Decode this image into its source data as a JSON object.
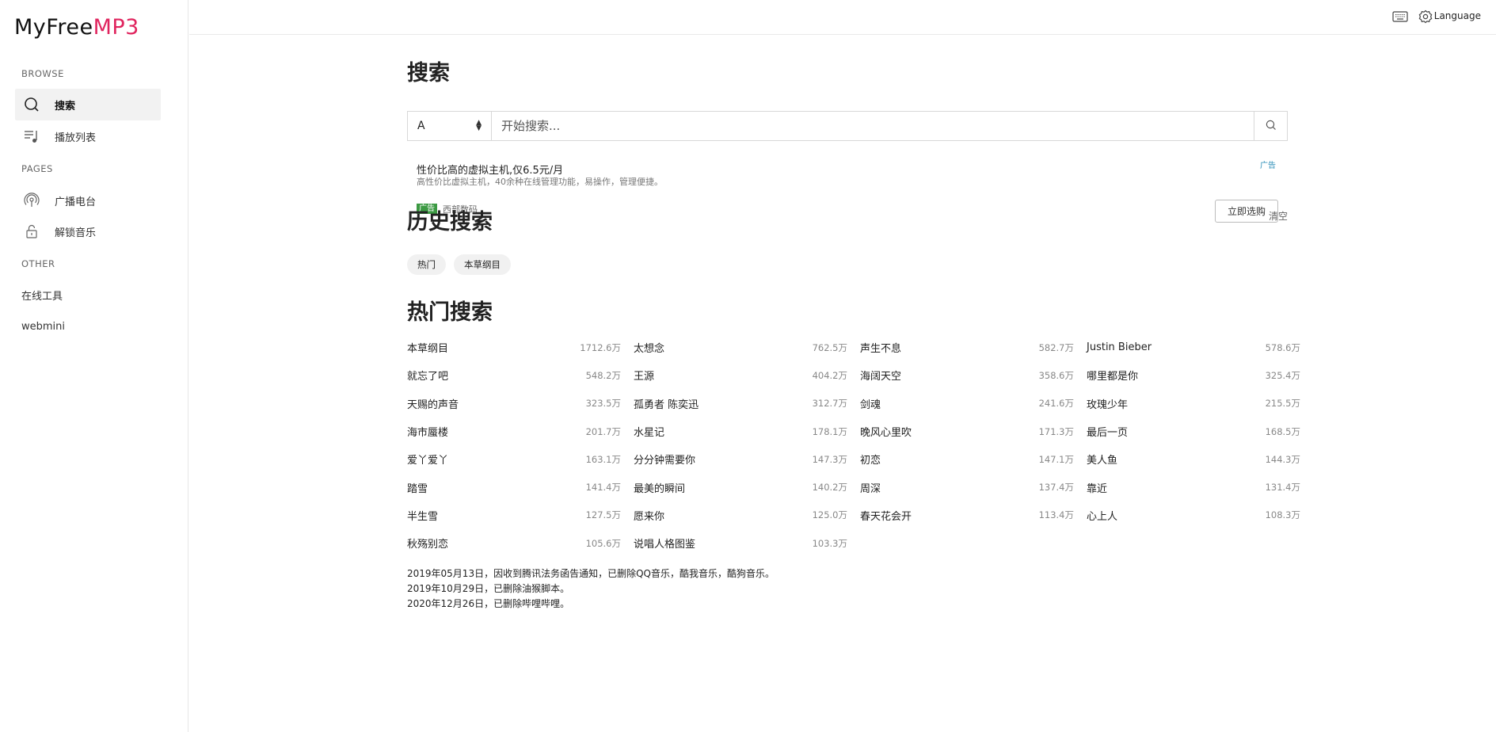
{
  "sidebar": {
    "logo_main": "MyFree",
    "logo_accent": "MP3",
    "sections": [
      {
        "title": "BROWSE",
        "items": [
          {
            "label": "搜索",
            "icon": "search-icon"
          },
          {
            "label": "播放列表",
            "icon": "playlist-icon"
          }
        ]
      },
      {
        "title": "PAGES",
        "items": [
          {
            "label": "广播电台",
            "icon": "podcast-icon"
          },
          {
            "label": "解锁音乐",
            "icon": "unlock-icon"
          }
        ]
      },
      {
        "title": "OTHER",
        "items": [
          {
            "label": "在线工具"
          },
          {
            "label": "webmini"
          }
        ]
      }
    ]
  },
  "topbar": {
    "keyboard_icon": "keyboard-icon",
    "settings_icon": "gear-icon",
    "language_label": "Language"
  },
  "search": {
    "title": "搜索",
    "source_value": "A",
    "placeholder": "开始搜索...",
    "button_icon": "search-icon"
  },
  "ad": {
    "title": "性价比高的虚拟主机,仅6.5元/月",
    "desc": "高性价比虚拟主机，40余种在线管理功能，易操作，管理便捷。",
    "tag": "广告",
    "badge": "广告",
    "brand": "西部数码",
    "button": "立即选购"
  },
  "history": {
    "title": "历史搜索",
    "clear_label": "清空",
    "chips": [
      "热门",
      "本草纲目"
    ]
  },
  "hot": {
    "title": "热门搜索",
    "items": [
      {
        "name": "本草纲目",
        "count": "1712.6万"
      },
      {
        "name": "太想念",
        "count": "762.5万"
      },
      {
        "name": "声生不息",
        "count": "582.7万"
      },
      {
        "name": "Justin Bieber",
        "count": "578.6万"
      },
      {
        "name": "就忘了吧",
        "count": "548.2万"
      },
      {
        "name": "王源",
        "count": "404.2万"
      },
      {
        "name": "海阔天空",
        "count": "358.6万"
      },
      {
        "name": "哪里都是你",
        "count": "325.4万"
      },
      {
        "name": "天赐的声音",
        "count": "323.5万"
      },
      {
        "name": "孤勇者 陈奕迅",
        "count": "312.7万"
      },
      {
        "name": "剑魂",
        "count": "241.6万"
      },
      {
        "name": "玫瑰少年",
        "count": "215.5万"
      },
      {
        "name": "海市蜃楼",
        "count": "201.7万"
      },
      {
        "name": "水星记",
        "count": "178.1万"
      },
      {
        "name": "晚风心里吹",
        "count": "171.3万"
      },
      {
        "name": "最后一页",
        "count": "168.5万"
      },
      {
        "name": "爱丫爱丫",
        "count": "163.1万"
      },
      {
        "name": "分分钟需要你",
        "count": "147.3万"
      },
      {
        "name": "初恋",
        "count": "147.1万"
      },
      {
        "name": "美人鱼",
        "count": "144.3万"
      },
      {
        "name": "踏雪",
        "count": "141.4万"
      },
      {
        "name": "最美的瞬间",
        "count": "140.2万"
      },
      {
        "name": "周深",
        "count": "137.4万"
      },
      {
        "name": "靠近",
        "count": "131.4万"
      },
      {
        "name": "半生雪",
        "count": "127.5万"
      },
      {
        "name": "愿来你",
        "count": "125.0万"
      },
      {
        "name": "春天花会开",
        "count": "113.4万"
      },
      {
        "name": "心上人",
        "count": "108.3万"
      },
      {
        "name": "秋殇别恋",
        "count": "105.6万"
      },
      {
        "name": "说唱人格图鉴",
        "count": "103.3万"
      }
    ]
  },
  "notes": [
    "2019年05月13日，因收到腾讯法务函告通知，已删除QQ音乐，酷我音乐，酷狗音乐。",
    "2019年10月29日，已删除油猴脚本。",
    "2020年12月26日，已删除哔哩哔哩。"
  ]
}
